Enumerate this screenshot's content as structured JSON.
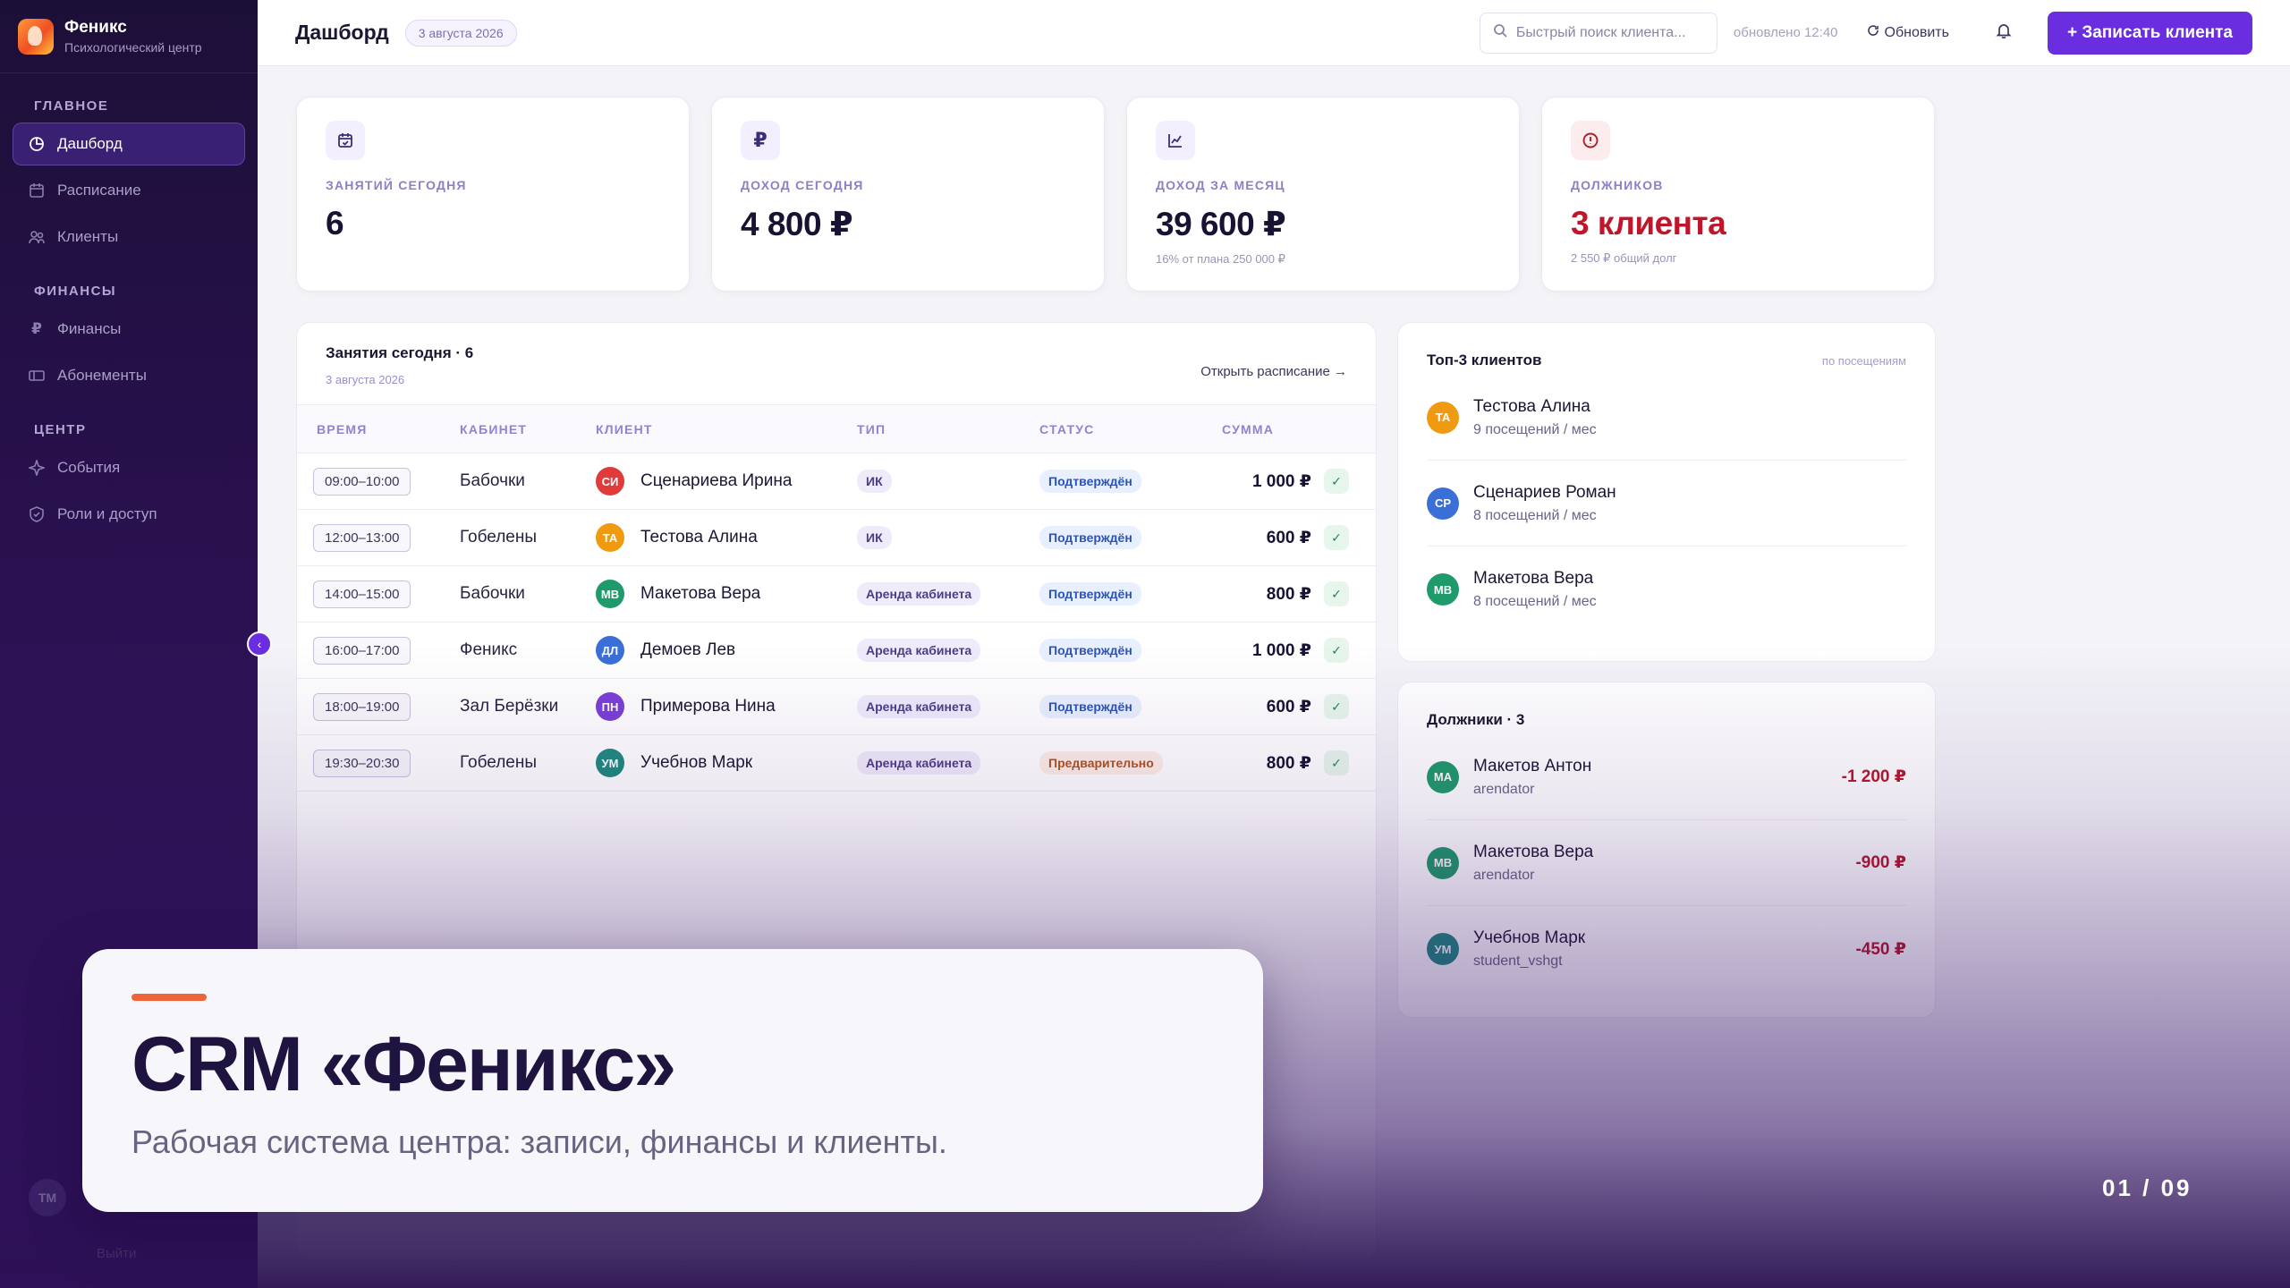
{
  "brand": {
    "name": "Феникс",
    "subtitle": "Психологический центр"
  },
  "sidebar": {
    "sections": [
      {
        "title": "ГЛАВНОЕ",
        "items": [
          {
            "label": "Дашборд",
            "icon": "dashboard-icon",
            "active": true
          },
          {
            "label": "Расписание",
            "icon": "calendar-icon"
          },
          {
            "label": "Клиенты",
            "icon": "users-icon"
          }
        ]
      },
      {
        "title": "ФИНАНСЫ",
        "items": [
          {
            "label": "Финансы",
            "icon": "ruble-icon"
          },
          {
            "label": "Абонементы",
            "icon": "ticket-icon"
          }
        ]
      },
      {
        "title": "ЦЕНТР",
        "items": [
          {
            "label": "События",
            "icon": "sparkle-icon"
          },
          {
            "label": "Роли и доступ",
            "icon": "shield-icon"
          }
        ]
      }
    ],
    "user_initials": "ТМ",
    "logout_label": "Выйти"
  },
  "topbar": {
    "title": "Дашборд",
    "date": "3 августа 2026",
    "search_placeholder": "Быстрый поиск клиента...",
    "updated": "обновлено 12:40",
    "refresh_label": "Обновить",
    "add_client_label": "+ Записать клиента"
  },
  "stats": [
    {
      "label": "ЗАНЯТИЙ СЕГОДНЯ",
      "value": "6",
      "sub": "",
      "icon": "calendar-check-icon"
    },
    {
      "label": "ДОХОД СЕГОДНЯ",
      "value": "4 800 ₽",
      "sub": "",
      "icon": "ruble-icon"
    },
    {
      "label": "ДОХОД ЗА МЕСЯЦ",
      "value": "39 600 ₽",
      "sub": "16% от плана 250 000 ₽",
      "icon": "chart-icon"
    },
    {
      "label": "ДОЛЖНИКОВ",
      "value": "3 клиента",
      "sub": "2 550 ₽ общий долг",
      "icon": "alert-icon"
    }
  ],
  "sessions": {
    "title": "Занятия сегодня · 6",
    "subtitle": "3 августа 2026",
    "open_link": "Открыть расписание →",
    "columns": [
      "ВРЕМЯ",
      "КАБИНЕТ",
      "КЛИЕНТ",
      "ТИП",
      "СТАТУС",
      "СУММА"
    ],
    "rows": [
      {
        "time": "09:00–10:00",
        "room": "Бабочки",
        "initials": "СИ",
        "avatar_color": "#e03a3a",
        "client": "Сценариева Ирина",
        "type": "ИК",
        "status": "Подтверждён",
        "status_kind": "confirmed",
        "sum": "1 000 ₽"
      },
      {
        "time": "12:00–13:00",
        "room": "Гобелены",
        "initials": "ТА",
        "avatar_color": "#f09a12",
        "client": "Тестова Алина",
        "type": "ИК",
        "status": "Подтверждён",
        "status_kind": "confirmed",
        "sum": "600 ₽"
      },
      {
        "time": "14:00–15:00",
        "room": "Бабочки",
        "initials": "МВ",
        "avatar_color": "#1f9a6a",
        "client": "Макетова Вера",
        "type": "Аренда кабинета",
        "status": "Подтверждён",
        "status_kind": "confirmed",
        "sum": "800 ₽"
      },
      {
        "time": "16:00–17:00",
        "room": "Феникс",
        "initials": "ДЛ",
        "avatar_color": "#3a6fd8",
        "client": "Демоев Лев",
        "type": "Аренда кабинета",
        "status": "Подтверждён",
        "status_kind": "confirmed",
        "sum": "1 000 ₽"
      },
      {
        "time": "18:00–19:00",
        "room": "Зал Берёзки",
        "initials": "ПН",
        "avatar_color": "#7b3fd6",
        "client": "Примерова Нина",
        "type": "Аренда кабинета",
        "status": "Подтверждён",
        "status_kind": "confirmed",
        "sum": "600 ₽"
      },
      {
        "time": "19:30–20:30",
        "room": "Гобелены",
        "initials": "УМ",
        "avatar_color": "#1f8a80",
        "client": "Учебнов Марк",
        "type": "Аренда кабинета",
        "status": "Предварительно",
        "status_kind": "pending",
        "sum": "800 ₽"
      }
    ]
  },
  "top_clients": {
    "title": "Топ-3 клиентов",
    "meta": "по посещениям",
    "items": [
      {
        "initials": "ТА",
        "avatar_color": "#f09a12",
        "name": "Тестова Алина",
        "sub": "9 посещений / мес"
      },
      {
        "initials": "СР",
        "avatar_color": "#3a6fd8",
        "name": "Сценариев Роман",
        "sub": "8 посещений / мес"
      },
      {
        "initials": "МВ",
        "avatar_color": "#1f9a6a",
        "name": "Макетова Вера",
        "sub": "8 посещений / мес"
      }
    ]
  },
  "debtors": {
    "title": "Должники · 3",
    "items": [
      {
        "initials": "МА",
        "avatar_color": "#1f9a6a",
        "name": "Макетов Антон",
        "sub": "arendator",
        "amount": "-1 200 ₽"
      },
      {
        "initials": "МВ",
        "avatar_color": "#1f9a6a",
        "name": "Макетова Вера",
        "sub": "arendator",
        "amount": "-900 ₽"
      },
      {
        "initials": "УМ",
        "avatar_color": "#1f8a80",
        "name": "Учебнов Марк",
        "sub": "student_vshgt",
        "amount": "-450 ₽"
      }
    ]
  },
  "hero": {
    "title": "CRM «Феникс»",
    "subtitle": "Рабочая система центра: записи, финансы и клиенты."
  },
  "slide_counter": "01 / 09"
}
